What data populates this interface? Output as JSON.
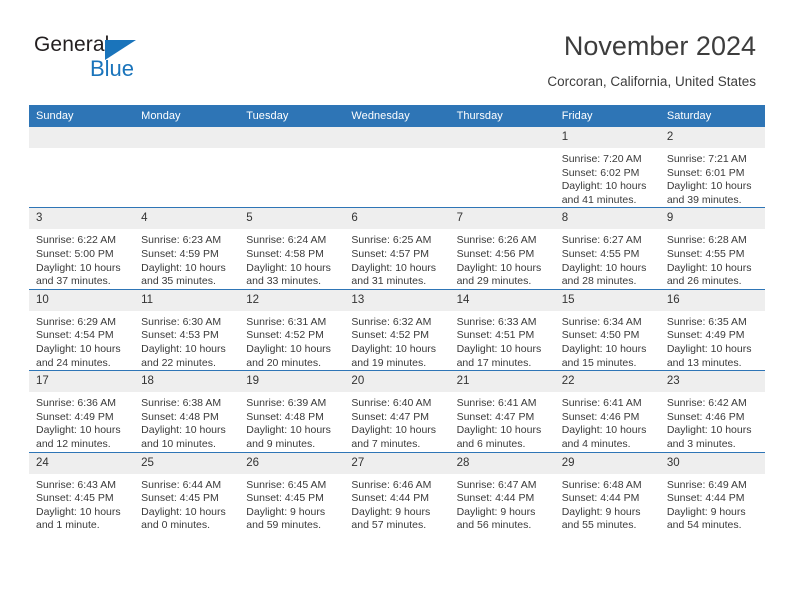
{
  "logo": {
    "word_one": "General",
    "word_two": "Blue",
    "triangle_color": "#1a74bb",
    "icon": "triangle-icon"
  },
  "header": {
    "title": "November 2024",
    "subtitle": "Corcoran, California, United States"
  },
  "theme": {
    "accent": "#2e75b6",
    "daynum_band": "#eeeeee",
    "text": "#3a3a3a"
  },
  "calendar": {
    "weekday_headers": [
      "Sunday",
      "Monday",
      "Tuesday",
      "Wednesday",
      "Thursday",
      "Friday",
      "Saturday"
    ],
    "labels": {
      "sunrise": "Sunrise:",
      "sunset": "Sunset:",
      "daylight": "Daylight:"
    },
    "weeks": [
      [
        {
          "day": "",
          "blank": true
        },
        {
          "day": "",
          "blank": true
        },
        {
          "day": "",
          "blank": true
        },
        {
          "day": "",
          "blank": true
        },
        {
          "day": "",
          "blank": true
        },
        {
          "day": "1",
          "sunrise": "Sunrise: 7:20 AM",
          "sunset": "Sunset: 6:02 PM",
          "daylight_1": "Daylight: 10 hours",
          "daylight_2": "and 41 minutes."
        },
        {
          "day": "2",
          "sunrise": "Sunrise: 7:21 AM",
          "sunset": "Sunset: 6:01 PM",
          "daylight_1": "Daylight: 10 hours",
          "daylight_2": "and 39 minutes."
        }
      ],
      [
        {
          "day": "3",
          "sunrise": "Sunrise: 6:22 AM",
          "sunset": "Sunset: 5:00 PM",
          "daylight_1": "Daylight: 10 hours",
          "daylight_2": "and 37 minutes."
        },
        {
          "day": "4",
          "sunrise": "Sunrise: 6:23 AM",
          "sunset": "Sunset: 4:59 PM",
          "daylight_1": "Daylight: 10 hours",
          "daylight_2": "and 35 minutes."
        },
        {
          "day": "5",
          "sunrise": "Sunrise: 6:24 AM",
          "sunset": "Sunset: 4:58 PM",
          "daylight_1": "Daylight: 10 hours",
          "daylight_2": "and 33 minutes."
        },
        {
          "day": "6",
          "sunrise": "Sunrise: 6:25 AM",
          "sunset": "Sunset: 4:57 PM",
          "daylight_1": "Daylight: 10 hours",
          "daylight_2": "and 31 minutes."
        },
        {
          "day": "7",
          "sunrise": "Sunrise: 6:26 AM",
          "sunset": "Sunset: 4:56 PM",
          "daylight_1": "Daylight: 10 hours",
          "daylight_2": "and 29 minutes."
        },
        {
          "day": "8",
          "sunrise": "Sunrise: 6:27 AM",
          "sunset": "Sunset: 4:55 PM",
          "daylight_1": "Daylight: 10 hours",
          "daylight_2": "and 28 minutes."
        },
        {
          "day": "9",
          "sunrise": "Sunrise: 6:28 AM",
          "sunset": "Sunset: 4:55 PM",
          "daylight_1": "Daylight: 10 hours",
          "daylight_2": "and 26 minutes."
        }
      ],
      [
        {
          "day": "10",
          "sunrise": "Sunrise: 6:29 AM",
          "sunset": "Sunset: 4:54 PM",
          "daylight_1": "Daylight: 10 hours",
          "daylight_2": "and 24 minutes."
        },
        {
          "day": "11",
          "sunrise": "Sunrise: 6:30 AM",
          "sunset": "Sunset: 4:53 PM",
          "daylight_1": "Daylight: 10 hours",
          "daylight_2": "and 22 minutes."
        },
        {
          "day": "12",
          "sunrise": "Sunrise: 6:31 AM",
          "sunset": "Sunset: 4:52 PM",
          "daylight_1": "Daylight: 10 hours",
          "daylight_2": "and 20 minutes."
        },
        {
          "day": "13",
          "sunrise": "Sunrise: 6:32 AM",
          "sunset": "Sunset: 4:52 PM",
          "daylight_1": "Daylight: 10 hours",
          "daylight_2": "and 19 minutes."
        },
        {
          "day": "14",
          "sunrise": "Sunrise: 6:33 AM",
          "sunset": "Sunset: 4:51 PM",
          "daylight_1": "Daylight: 10 hours",
          "daylight_2": "and 17 minutes."
        },
        {
          "day": "15",
          "sunrise": "Sunrise: 6:34 AM",
          "sunset": "Sunset: 4:50 PM",
          "daylight_1": "Daylight: 10 hours",
          "daylight_2": "and 15 minutes."
        },
        {
          "day": "16",
          "sunrise": "Sunrise: 6:35 AM",
          "sunset": "Sunset: 4:49 PM",
          "daylight_1": "Daylight: 10 hours",
          "daylight_2": "and 13 minutes."
        }
      ],
      [
        {
          "day": "17",
          "sunrise": "Sunrise: 6:36 AM",
          "sunset": "Sunset: 4:49 PM",
          "daylight_1": "Daylight: 10 hours",
          "daylight_2": "and 12 minutes."
        },
        {
          "day": "18",
          "sunrise": "Sunrise: 6:38 AM",
          "sunset": "Sunset: 4:48 PM",
          "daylight_1": "Daylight: 10 hours",
          "daylight_2": "and 10 minutes."
        },
        {
          "day": "19",
          "sunrise": "Sunrise: 6:39 AM",
          "sunset": "Sunset: 4:48 PM",
          "daylight_1": "Daylight: 10 hours",
          "daylight_2": "and 9 minutes."
        },
        {
          "day": "20",
          "sunrise": "Sunrise: 6:40 AM",
          "sunset": "Sunset: 4:47 PM",
          "daylight_1": "Daylight: 10 hours",
          "daylight_2": "and 7 minutes."
        },
        {
          "day": "21",
          "sunrise": "Sunrise: 6:41 AM",
          "sunset": "Sunset: 4:47 PM",
          "daylight_1": "Daylight: 10 hours",
          "daylight_2": "and 6 minutes."
        },
        {
          "day": "22",
          "sunrise": "Sunrise: 6:41 AM",
          "sunset": "Sunset: 4:46 PM",
          "daylight_1": "Daylight: 10 hours",
          "daylight_2": "and 4 minutes."
        },
        {
          "day": "23",
          "sunrise": "Sunrise: 6:42 AM",
          "sunset": "Sunset: 4:46 PM",
          "daylight_1": "Daylight: 10 hours",
          "daylight_2": "and 3 minutes."
        }
      ],
      [
        {
          "day": "24",
          "sunrise": "Sunrise: 6:43 AM",
          "sunset": "Sunset: 4:45 PM",
          "daylight_1": "Daylight: 10 hours",
          "daylight_2": "and 1 minute."
        },
        {
          "day": "25",
          "sunrise": "Sunrise: 6:44 AM",
          "sunset": "Sunset: 4:45 PM",
          "daylight_1": "Daylight: 10 hours",
          "daylight_2": "and 0 minutes."
        },
        {
          "day": "26",
          "sunrise": "Sunrise: 6:45 AM",
          "sunset": "Sunset: 4:45 PM",
          "daylight_1": "Daylight: 9 hours",
          "daylight_2": "and 59 minutes."
        },
        {
          "day": "27",
          "sunrise": "Sunrise: 6:46 AM",
          "sunset": "Sunset: 4:44 PM",
          "daylight_1": "Daylight: 9 hours",
          "daylight_2": "and 57 minutes."
        },
        {
          "day": "28",
          "sunrise": "Sunrise: 6:47 AM",
          "sunset": "Sunset: 4:44 PM",
          "daylight_1": "Daylight: 9 hours",
          "daylight_2": "and 56 minutes."
        },
        {
          "day": "29",
          "sunrise": "Sunrise: 6:48 AM",
          "sunset": "Sunset: 4:44 PM",
          "daylight_1": "Daylight: 9 hours",
          "daylight_2": "and 55 minutes."
        },
        {
          "day": "30",
          "sunrise": "Sunrise: 6:49 AM",
          "sunset": "Sunset: 4:44 PM",
          "daylight_1": "Daylight: 9 hours",
          "daylight_2": "and 54 minutes."
        }
      ]
    ]
  }
}
